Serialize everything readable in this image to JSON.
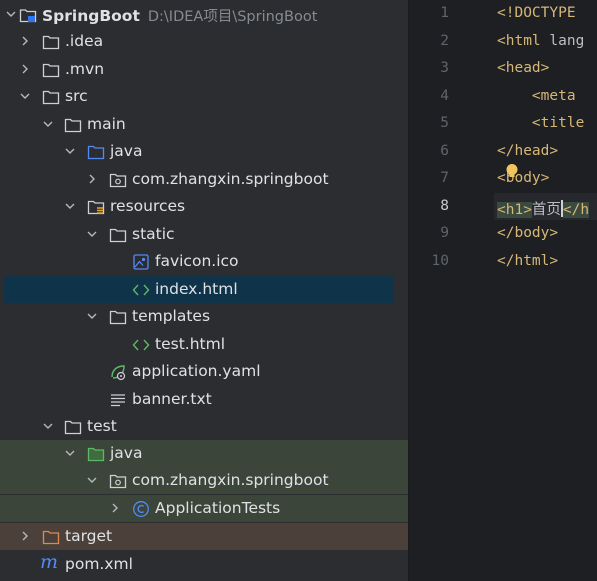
{
  "project_tree": {
    "root": {
      "label": "SpringBoot",
      "path": "D:\\IDEA项目\\SpringBoot"
    },
    "items": [
      {
        "label": ".idea"
      },
      {
        "label": ".mvn"
      },
      {
        "label": "src"
      },
      {
        "label": "main"
      },
      {
        "label": "java"
      },
      {
        "label": "com.zhangxin.springboot"
      },
      {
        "label": "resources"
      },
      {
        "label": "static"
      },
      {
        "label": "favicon.ico"
      },
      {
        "label": "index.html"
      },
      {
        "label": "templates"
      },
      {
        "label": "test.html"
      },
      {
        "label": "application.yaml"
      },
      {
        "label": "banner.txt"
      },
      {
        "label": "test"
      },
      {
        "label": "java"
      },
      {
        "label": "com.zhangxin.springboot"
      },
      {
        "label": "ApplicationTests"
      },
      {
        "label": "target"
      },
      {
        "label": "pom.xml"
      }
    ]
  },
  "editor": {
    "line_numbers": [
      "1",
      "2",
      "3",
      "4",
      "5",
      "6",
      "7",
      "8",
      "9",
      "10"
    ],
    "current_line": "8",
    "lines": {
      "l1": "<!DOCTYPE",
      "l2a": "<html",
      "l2b": " lang",
      "l3": "<head>",
      "l4": "    <meta",
      "l5": "    <title",
      "l6": "</head>",
      "l7": "<body>",
      "l8a": "<h1>",
      "l8b": "首页",
      "l8c": "</h",
      "l9": "</body>",
      "l10": "</html>"
    }
  },
  "colors": {
    "tree_bg": "#2b2d30",
    "editor_bg": "#1e1f22",
    "selection": "#0f3349",
    "tag": "#d5b778",
    "test_bg": "#3c4539",
    "excluded_bg": "#4b413a"
  }
}
